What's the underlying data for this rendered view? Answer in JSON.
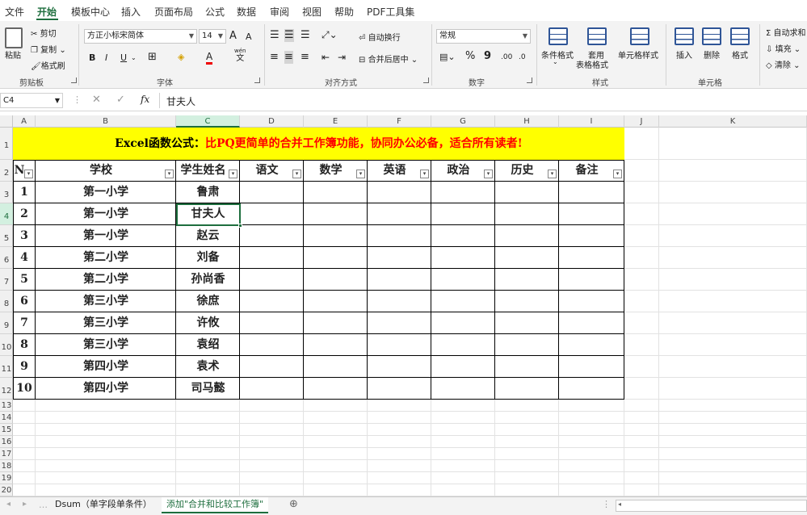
{
  "menu": {
    "tabs": [
      "文件",
      "开始",
      "模板中心",
      "插入",
      "页面布局",
      "公式",
      "数据",
      "审阅",
      "视图",
      "帮助",
      "PDF工具集"
    ],
    "active": "开始"
  },
  "ribbon": {
    "clipboard": {
      "paste": "粘贴",
      "cut": "剪切",
      "copy": "复制",
      "format_painter": "格式刷",
      "group": "剪贴板"
    },
    "font": {
      "name": "方正小标宋简体",
      "size": "14",
      "grow": "A",
      "shrink": "A",
      "bold": "B",
      "italic": "I",
      "underline": "U",
      "wen": "wén",
      "wen_char": "文",
      "group": "字体"
    },
    "align": {
      "wrap": "自动换行",
      "merge": "合并后居中",
      "group": "对齐方式"
    },
    "number": {
      "format": "常规",
      "percent": "%",
      "comma": "9",
      "inc": ".00",
      "dec": ".0",
      "group": "数字"
    },
    "styles": {
      "conditional": "条件格式",
      "table_l1": "套用",
      "table_l2": "表格格式",
      "cell_styles": "单元格样式",
      "group": "样式"
    },
    "cells": {
      "insert": "插入",
      "delete": "删除",
      "format": "格式",
      "group": "单元格"
    },
    "editing": {
      "autosum": "自动求和",
      "fill": "填充",
      "clear": "清除"
    }
  },
  "formula_bar": {
    "name_box": "C4",
    "fx": "fx",
    "content": "甘夫人"
  },
  "sheet": {
    "columns": [
      "A",
      "B",
      "C",
      "D",
      "E",
      "F",
      "G",
      "H",
      "I",
      "J",
      "K"
    ],
    "rows": [
      "1",
      "2",
      "3",
      "4",
      "5",
      "6",
      "7",
      "8",
      "9",
      "10",
      "11",
      "12",
      "13",
      "14",
      "15",
      "16",
      "17",
      "18",
      "19",
      "20"
    ],
    "selected_col": "C",
    "selected_row": "4",
    "banner_part1": "Excel函数公式：",
    "banner_part2": "比PQ更简单的合并工作簿功能，协同办公必备，适合所有读者!",
    "headers": [
      "N",
      "学校",
      "学生姓名",
      "语文",
      "数学",
      "英语",
      "政治",
      "历史",
      "备注"
    ],
    "data": [
      [
        "1",
        "第一小学",
        "鲁肃"
      ],
      [
        "2",
        "第一小学",
        "甘夫人"
      ],
      [
        "3",
        "第一小学",
        "赵云"
      ],
      [
        "4",
        "第二小学",
        "刘备"
      ],
      [
        "5",
        "第二小学",
        "孙尚香"
      ],
      [
        "6",
        "第三小学",
        "徐庶"
      ],
      [
        "7",
        "第三小学",
        "许攸"
      ],
      [
        "8",
        "第三小学",
        "袁绍"
      ],
      [
        "9",
        "第四小学",
        "袁术"
      ],
      [
        "10",
        "第四小学",
        "司马懿"
      ]
    ]
  },
  "sheet_tabs": {
    "tabs": [
      "Dsum（单字段单条件）",
      "添加\"合并和比较工作簿\""
    ],
    "active_index": 1,
    "add": "⊕"
  }
}
